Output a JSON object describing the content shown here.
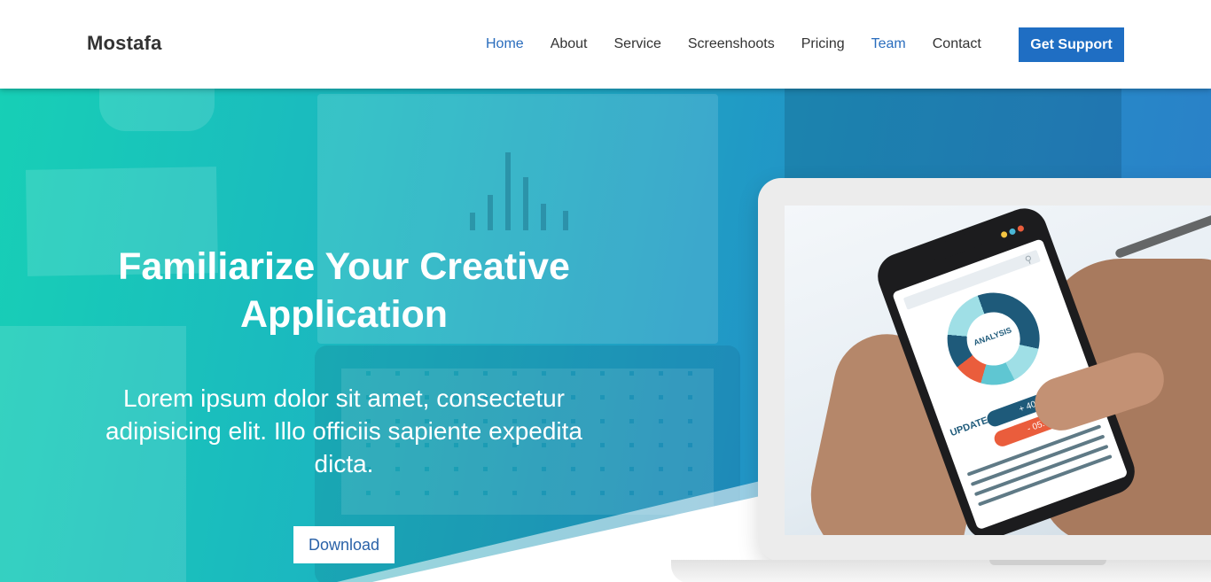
{
  "brand": {
    "name": "Mostafa"
  },
  "nav": {
    "items": [
      {
        "label": "Home",
        "active": true
      },
      {
        "label": "About",
        "active": false
      },
      {
        "label": "Service",
        "active": false
      },
      {
        "label": "Screenshoots",
        "active": false
      },
      {
        "label": "Pricing",
        "active": false
      },
      {
        "label": "Team",
        "active": true
      },
      {
        "label": "Contact",
        "active": false
      }
    ],
    "cta_label": "Get Support"
  },
  "hero": {
    "title": "Familiarize Your Creative Application",
    "text": "Lorem ipsum dolor sit amet, consectetur adipisicing elit. Illo officiis sapiente expedita dicta.",
    "button_label": "Download"
  },
  "phone_app": {
    "chart_label": "ANALYSIS",
    "update_label": "UPDATE",
    "gain": "+ 40.25 $",
    "loss": "- 05.75 $"
  },
  "colors": {
    "accent": "#1f6ec3",
    "active_link": "#2a6dbd",
    "hero_gradient_start": "#17cfb6",
    "hero_gradient_end": "#2b7ec9",
    "chart_primary": "#1e5a7a",
    "chart_alert": "#ea5d3c"
  }
}
